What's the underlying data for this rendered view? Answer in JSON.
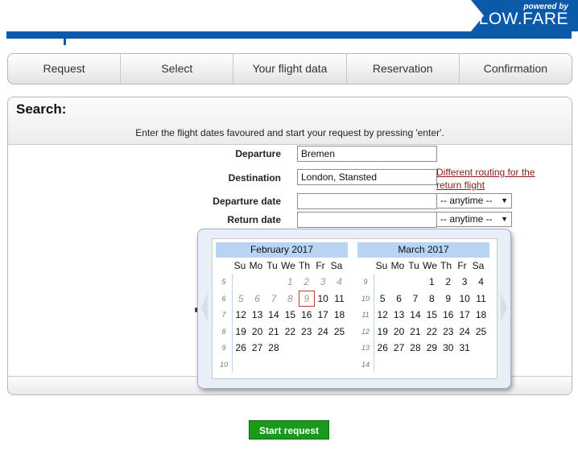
{
  "header": {
    "powered_by": "powered by",
    "brand": "LOW.FARE",
    "brand_color": "#0b5aa9"
  },
  "steps": [
    "Request",
    "Select",
    "Your flight data",
    "Reservation",
    "Confirmation"
  ],
  "search": {
    "title": "Search:",
    "instruction": "Enter the flight dates favoured and start your request by pressing 'enter'.",
    "departure": {
      "label": "Departure",
      "value": "Bremen"
    },
    "destination": {
      "label": "Destination",
      "value": "London, Stansted",
      "link": "Different routing for the return flight"
    },
    "departure_date": {
      "label": "Departure date",
      "value": "",
      "time": "-- anytime --"
    },
    "return_date": {
      "label": "Return date",
      "value": "",
      "time": "-- anytime --"
    }
  },
  "calendar": {
    "weekdays": [
      "Su",
      "Mo",
      "Tu",
      "We",
      "Th",
      "Fr",
      "Sa"
    ],
    "months": [
      {
        "title": "February 2017",
        "weeks": [
          "5",
          "6",
          "7",
          "8",
          "9",
          "10"
        ],
        "first_weekday": 3,
        "days": 28,
        "past_until": 8,
        "today": 9
      },
      {
        "title": "March 2017",
        "weeks": [
          "9",
          "10",
          "11",
          "12",
          "13",
          "14"
        ],
        "first_weekday": 3,
        "days": 31,
        "past_until": 0,
        "today": 0
      }
    ]
  },
  "start_button": "Start request",
  "colors": {
    "accent": "#0b5aa9",
    "month_header": "#b8d4f2",
    "start_button": "#189a1b",
    "link": "#8b1a1a"
  }
}
